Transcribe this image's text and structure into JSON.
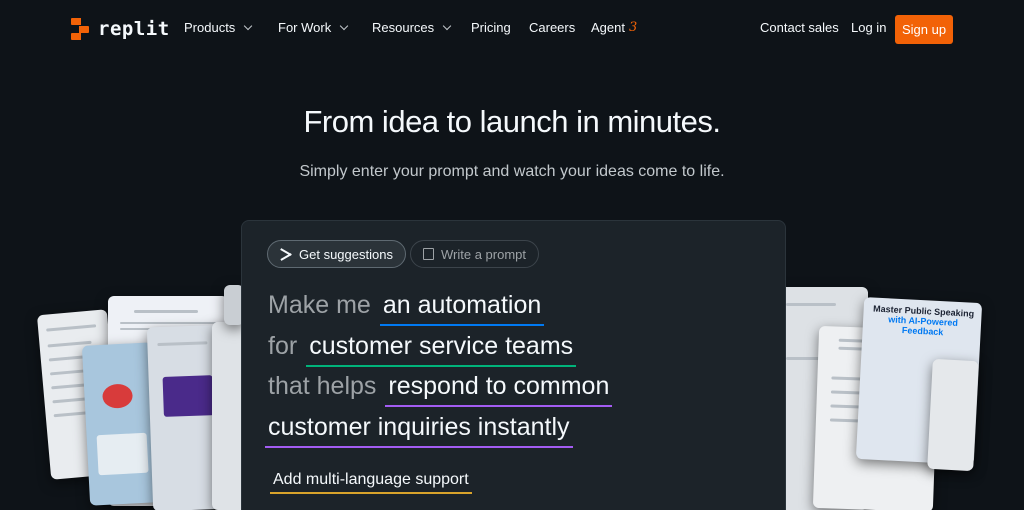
{
  "brand": {
    "name": "replit",
    "accent": "#f26207"
  },
  "nav": {
    "products": "Products",
    "for_work": "For Work",
    "resources": "Resources",
    "pricing": "Pricing",
    "careers": "Careers",
    "agent": "Agent",
    "agent_version": "3",
    "contact_sales": "Contact sales",
    "login": "Log in",
    "signup": "Sign up"
  },
  "hero": {
    "title": "From idea to launch in minutes.",
    "subtitle": "Simply enter your prompt and watch your ideas come to life."
  },
  "prompt": {
    "tabs": [
      {
        "label": "Get suggestions",
        "icon": "shuffle-icon",
        "active": true
      },
      {
        "label": "Write a prompt",
        "icon": "edit-icon",
        "active": false
      }
    ],
    "lines": [
      {
        "prefix": "Make me",
        "highlight": "an automation",
        "color": "#0079f2"
      },
      {
        "prefix": "for",
        "highlight": "customer service teams",
        "color": "#00b37a"
      },
      {
        "prefix": "that helps",
        "highlight": "respond to common",
        "color": "#a35cf2"
      },
      {
        "prefix": "",
        "highlight": "customer inquiries instantly",
        "color": "#a35cf2"
      }
    ],
    "suggestion": "Add multi-language support"
  },
  "preview_cards": {
    "public_speaking_title": "Master Public Speaking",
    "public_speaking_highlight": "with AI-Powered Feedback"
  }
}
